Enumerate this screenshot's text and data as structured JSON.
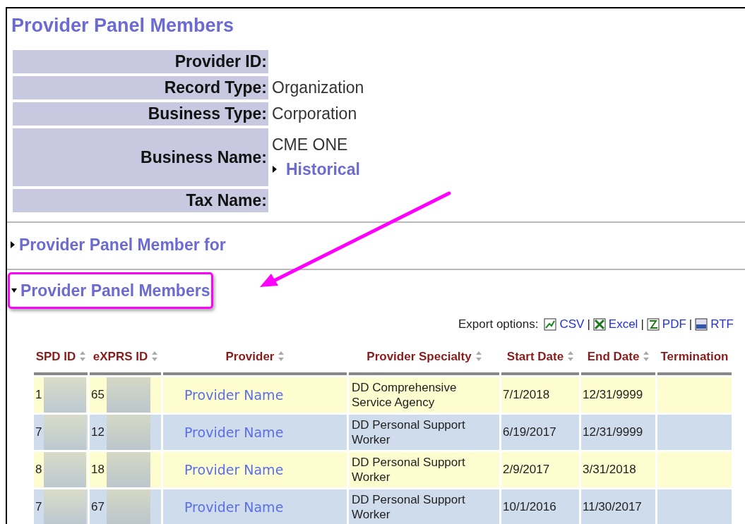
{
  "title": "Provider Panel Members",
  "details": [
    {
      "label": "Provider ID:"
    },
    {
      "label": "Record Type:",
      "value": "Organization"
    },
    {
      "label": "Business Type:",
      "value": "Corporation"
    },
    {
      "label": "Business Name:",
      "value": "CME ONE",
      "link": {
        "text": "Historical",
        "expanded": false
      }
    },
    {
      "label": "Tax Name:"
    }
  ],
  "sections": [
    {
      "title": "Provider Panel Member for",
      "expanded": false,
      "highlighted": false
    },
    {
      "title": "Provider Panel Members",
      "expanded": true,
      "highlighted": true
    }
  ],
  "export": {
    "label": "Export options:",
    "separator": "|",
    "formats": [
      {
        "kind": "csv",
        "text": "CSV"
      },
      {
        "kind": "excel",
        "text": "Excel"
      },
      {
        "kind": "pdf",
        "text": "PDF"
      },
      {
        "kind": "rtf",
        "text": "RTF"
      }
    ]
  },
  "table": {
    "columns": [
      "SPD ID",
      "eXPRS ID",
      "Provider",
      "Provider Specialty",
      "Start Date",
      "End Date",
      "Termination"
    ],
    "rows": [
      {
        "spd_id": "1",
        "exprs_id": "65",
        "provider": "Provider Name",
        "specialty": "DD Comprehensive Service Agency",
        "start": "7/1/2018",
        "end": "12/31/9999"
      },
      {
        "spd_id": "7",
        "exprs_id": "12",
        "provider": "Provider Name",
        "specialty": "DD Personal Support Worker",
        "start": "6/19/2017",
        "end": "12/31/9999"
      },
      {
        "spd_id": "8",
        "exprs_id": "18",
        "provider": "Provider Name",
        "specialty": "DD Personal Support Worker",
        "start": "2/9/2017",
        "end": "3/31/2018"
      },
      {
        "spd_id": "7",
        "exprs_id": "67",
        "provider": "Provider Name",
        "specialty": "DD Personal Support Worker",
        "start": "10/1/2016",
        "end": "11/30/2017"
      }
    ]
  }
}
